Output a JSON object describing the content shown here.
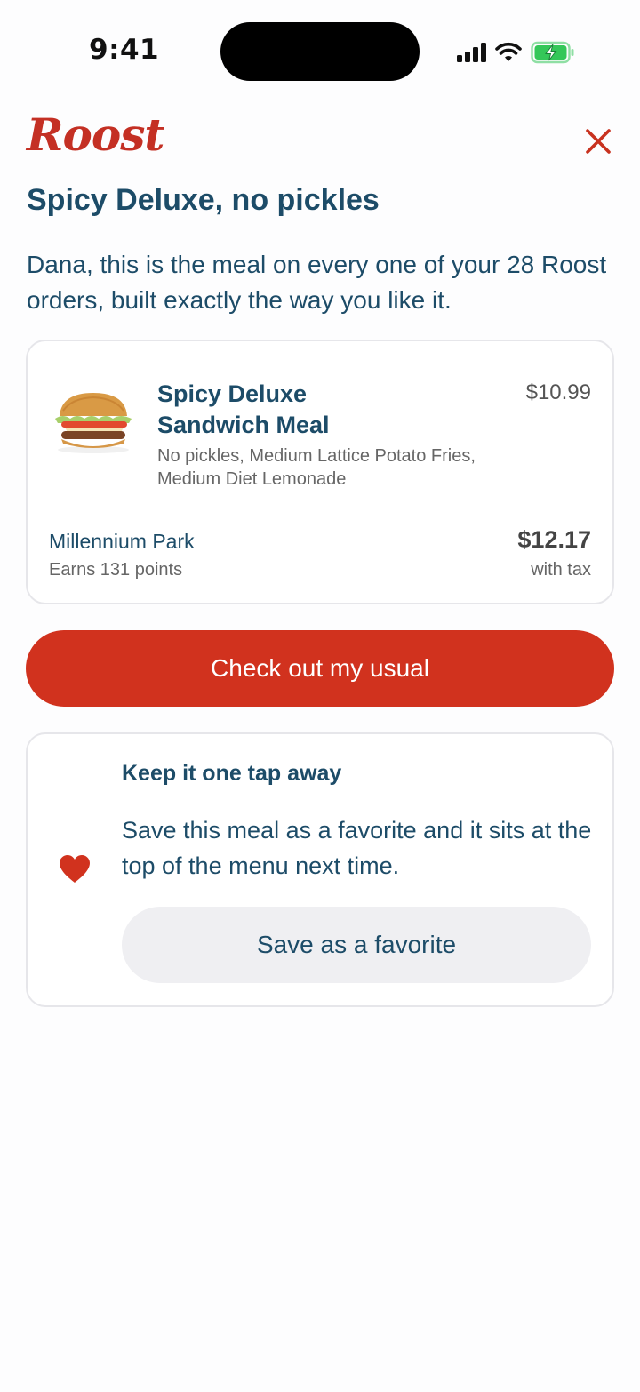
{
  "status_bar": {
    "time": "9:41",
    "icons": [
      "cellular-signal-icon",
      "wifi-icon",
      "battery-charging-icon"
    ]
  },
  "header": {
    "brand": "Roost",
    "close_icon": "close-icon"
  },
  "page": {
    "title": "Spicy Deluxe, no pickles",
    "intro": "Dana, this is the meal on every one of your 28 Roost orders, built exactly the way you like it."
  },
  "order_card": {
    "item_name": "Spicy Deluxe Sandwich Meal",
    "item_price": "$10.99",
    "modifiers": "No pickles, Medium Lattice Potato Fries, Medium Diet Lemonade",
    "store": "Millennium Park",
    "points": "Earns 131 points",
    "total": "$12.17",
    "total_note": "with tax"
  },
  "checkout": {
    "label": "Check out my usual"
  },
  "favorite_card": {
    "icon": "heart-icon",
    "title": "Keep it one tap away",
    "description": "Save this meal as a favorite and it sits at the top of the menu next time.",
    "button_label": "Save as a favorite"
  },
  "colors": {
    "brand_red": "#d1321e",
    "navy": "#1d4c68",
    "battery_green": "#34c759"
  }
}
